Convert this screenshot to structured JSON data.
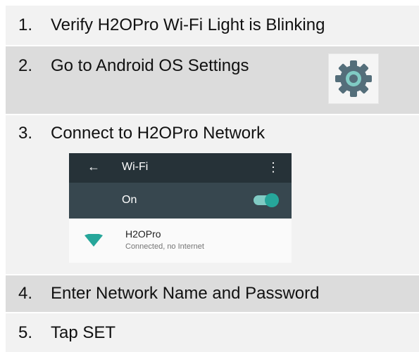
{
  "steps": [
    {
      "number": "1.",
      "text": "Verify H2OPro Wi-Fi Light is Blinking"
    },
    {
      "number": "2.",
      "text": "Go to Android OS Settings"
    },
    {
      "number": "3.",
      "text": "Connect to H2OPro Network"
    },
    {
      "number": "4.",
      "text": "Enter Network Name and Password"
    },
    {
      "number": "5.",
      "text": "Tap SET"
    }
  ],
  "settings_icon": {
    "name": "settings-gear-icon",
    "color": "#546e7a",
    "accent": "#80cbc4"
  },
  "wifi_screen": {
    "back_icon": "←",
    "title": "Wi-Fi",
    "menu_icon": "⋮",
    "toggle_label": "On",
    "toggle_on": true,
    "network": {
      "ssid": "H2OPro",
      "status": "Connected, no Internet"
    },
    "colors": {
      "topbar": "#263238",
      "onbar": "#37474f",
      "accent": "#26a69a"
    }
  }
}
